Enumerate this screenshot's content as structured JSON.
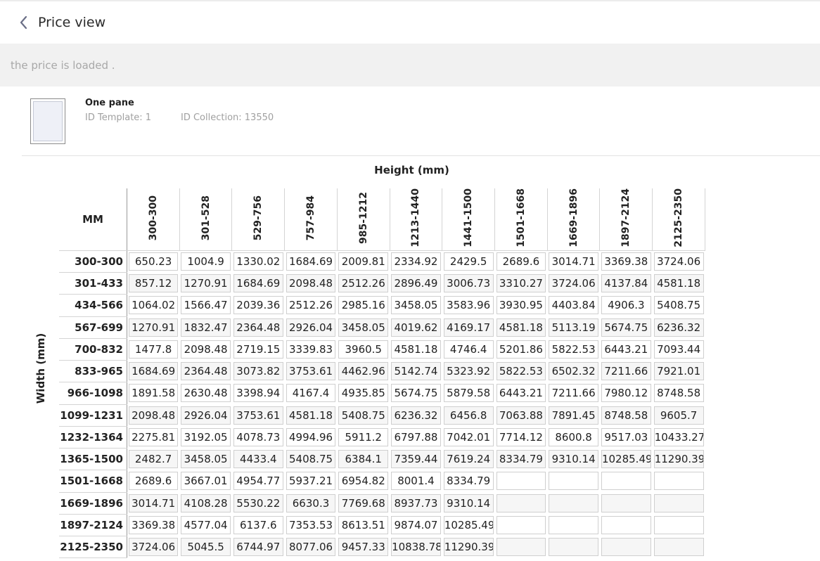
{
  "header": {
    "title": "Price view"
  },
  "status": {
    "message": "the price is loaded ."
  },
  "product": {
    "name": "One pane",
    "template": "ID Template: 1",
    "collection": "ID Collection: 13550"
  },
  "table": {
    "corner": "MM",
    "height_label": "Height (mm)",
    "width_label": "Width (mm)",
    "columns": [
      "300-300",
      "301-528",
      "529-756",
      "757-984",
      "985-1212",
      "1213-1440",
      "1441-1500",
      "1501-1668",
      "1669-1896",
      "1897-2124",
      "2125-2350"
    ],
    "rows": [
      {
        "label": "300-300",
        "values": [
          "650.23",
          "1004.9",
          "1330.02",
          "1684.69",
          "2009.81",
          "2334.92",
          "2429.5",
          "2689.6",
          "3014.71",
          "3369.38",
          "3724.06"
        ]
      },
      {
        "label": "301-433",
        "values": [
          "857.12",
          "1270.91",
          "1684.69",
          "2098.48",
          "2512.26",
          "2896.49",
          "3006.73",
          "3310.27",
          "3724.06",
          "4137.84",
          "4581.18"
        ]
      },
      {
        "label": "434-566",
        "values": [
          "1064.02",
          "1566.47",
          "2039.36",
          "2512.26",
          "2985.16",
          "3458.05",
          "3583.96",
          "3930.95",
          "4403.84",
          "4906.3",
          "5408.75"
        ]
      },
      {
        "label": "567-699",
        "values": [
          "1270.91",
          "1832.47",
          "2364.48",
          "2926.04",
          "3458.05",
          "4019.62",
          "4169.17",
          "4581.18",
          "5113.19",
          "5674.75",
          "6236.32"
        ]
      },
      {
        "label": "700-832",
        "values": [
          "1477.8",
          "2098.48",
          "2719.15",
          "3339.83",
          "3960.5",
          "4581.18",
          "4746.4",
          "5201.86",
          "5822.53",
          "6443.21",
          "7093.44"
        ]
      },
      {
        "label": "833-965",
        "values": [
          "1684.69",
          "2364.48",
          "3073.82",
          "3753.61",
          "4462.96",
          "5142.74",
          "5323.92",
          "5822.53",
          "6502.32",
          "7211.66",
          "7921.01"
        ]
      },
      {
        "label": "966-1098",
        "values": [
          "1891.58",
          "2630.48",
          "3398.94",
          "4167.4",
          "4935.85",
          "5674.75",
          "5879.58",
          "6443.21",
          "7211.66",
          "7980.12",
          "8748.58"
        ]
      },
      {
        "label": "1099-1231",
        "values": [
          "2098.48",
          "2926.04",
          "3753.61",
          "4581.18",
          "5408.75",
          "6236.32",
          "6456.8",
          "7063.88",
          "7891.45",
          "8748.58",
          "9605.7"
        ]
      },
      {
        "label": "1232-1364",
        "values": [
          "2275.81",
          "3192.05",
          "4078.73",
          "4994.96",
          "5911.2",
          "6797.88",
          "7042.01",
          "7714.12",
          "8600.8",
          "9517.03",
          "10433.27"
        ]
      },
      {
        "label": "1365-1500",
        "values": [
          "2482.7",
          "3458.05",
          "4433.4",
          "5408.75",
          "6384.1",
          "7359.44",
          "7619.24",
          "8334.79",
          "9310.14",
          "10285.49",
          "11290.39"
        ]
      },
      {
        "label": "1501-1668",
        "values": [
          "2689.6",
          "3667.01",
          "4954.77",
          "5937.21",
          "6954.82",
          "8001.4",
          "8334.79",
          "",
          "",
          "",
          ""
        ]
      },
      {
        "label": "1669-1896",
        "values": [
          "3014.71",
          "4108.28",
          "5530.22",
          "6630.3",
          "7769.68",
          "8937.73",
          "9310.14",
          "",
          "",
          "",
          ""
        ]
      },
      {
        "label": "1897-2124",
        "values": [
          "3369.38",
          "4577.04",
          "6137.6",
          "7353.53",
          "8613.51",
          "9874.07",
          "10285.49",
          "",
          "",
          "",
          ""
        ]
      },
      {
        "label": "2125-2350",
        "values": [
          "3724.06",
          "5045.5",
          "6744.97",
          "8077.06",
          "9457.33",
          "10838.78",
          "11290.39",
          "",
          "",
          "",
          ""
        ]
      }
    ]
  }
}
